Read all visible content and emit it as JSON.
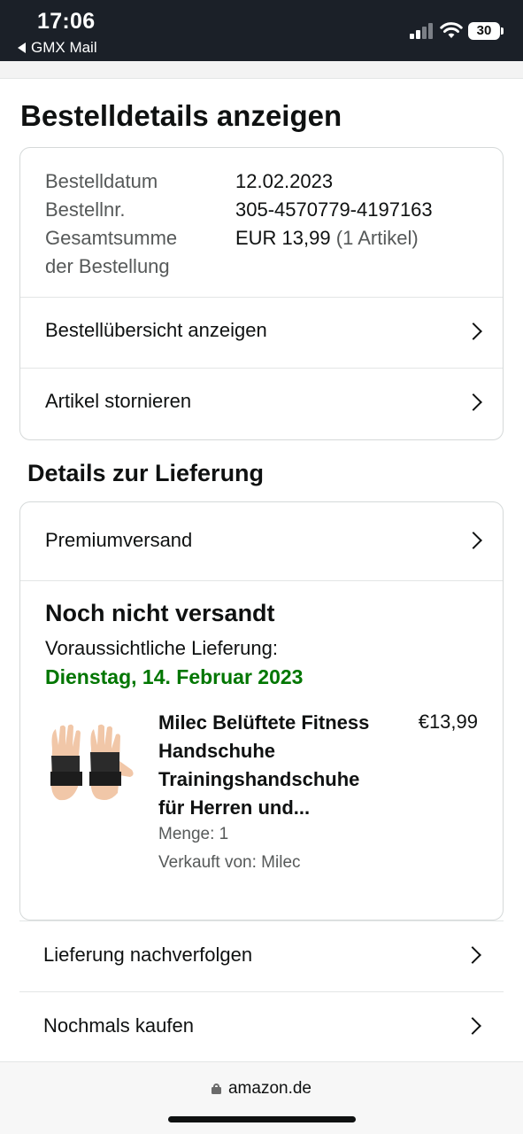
{
  "status_bar": {
    "time": "17:06",
    "back_app": "GMX Mail",
    "battery": "30"
  },
  "page": {
    "title": "Bestelldetails anzeigen"
  },
  "order_info": {
    "date_label": "Bestelldatum",
    "date_value": "12.02.2023",
    "number_label": "Bestellnr.",
    "number_value": "305-4570779-4197163",
    "total_label_line1": "Gesamtsumme",
    "total_label_line2": "der Bestellung",
    "total_value": "EUR 13,99",
    "total_items": "(1 Artikel)"
  },
  "order_actions": [
    {
      "label": "Bestellübersicht anzeigen"
    },
    {
      "label": "Artikel stornieren"
    }
  ],
  "delivery": {
    "section_title": "Details zur Lieferung",
    "shipping_method": "Premiumversand",
    "status": "Noch nicht versandt",
    "estimate_label": "Voraussichtliche Lieferung:",
    "estimate_date": "Dienstag, 14. Februar 2023",
    "product": {
      "name": "Milec Belüftete Fitness Handschuhe Trainingshandschuhe für Herren und...",
      "price": "€13,99",
      "quantity": "Menge: 1",
      "seller": "Verkauft von: Milec"
    }
  },
  "bottom_actions": [
    {
      "label": "Lieferung nachverfolgen"
    },
    {
      "label": "Nochmals kaufen"
    }
  ],
  "browser": {
    "domain": "amazon.de"
  },
  "colors": {
    "status_bar_bg": "#1b2028",
    "delivery_date_green": "#007600",
    "border": "#d5d9d9",
    "muted_text": "#565959"
  }
}
